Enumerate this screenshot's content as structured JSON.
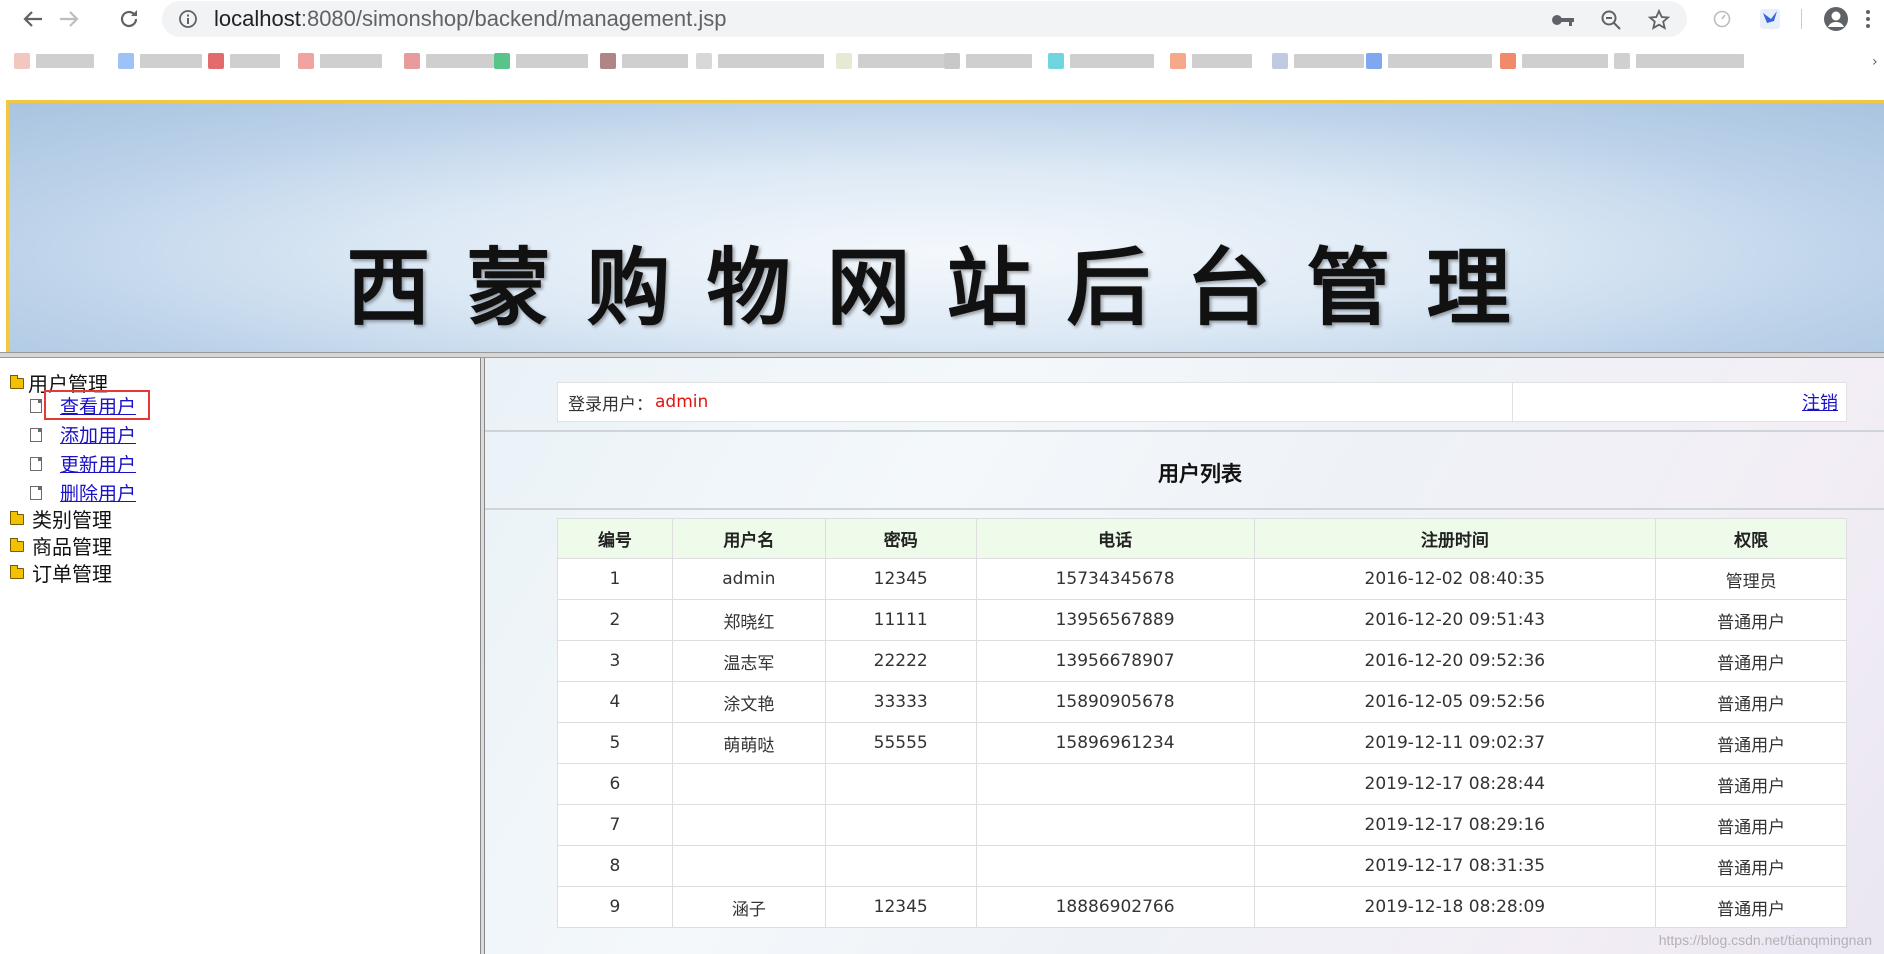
{
  "browser": {
    "url_host": "localhost",
    "url_rest": ":8080/simonshop/backend/management.jsp",
    "bookmark_count": 14
  },
  "header": {
    "title": "西蒙购物网站后台管理"
  },
  "sidebar": {
    "groups": [
      {
        "label": "用户管理",
        "children": [
          "查看用户",
          "添加用户",
          "更新用户",
          "删除用户"
        ]
      },
      {
        "label": "类别管理"
      },
      {
        "label": "商品管理"
      },
      {
        "label": "订单管理"
      }
    ],
    "selected": "查看用户"
  },
  "login": {
    "label": "登录用户：",
    "username": "admin",
    "logout": "注销"
  },
  "list": {
    "title": "用户列表",
    "columns": [
      "编号",
      "用户名",
      "密码",
      "电话",
      "注册时间",
      "权限"
    ],
    "rows": [
      [
        "1",
        "admin",
        "12345",
        "15734345678",
        "2016-12-02 08:40:35",
        "管理员"
      ],
      [
        "2",
        "郑晓红",
        "11111",
        "13956567889",
        "2016-12-20 09:51:43",
        "普通用户"
      ],
      [
        "3",
        "温志军",
        "22222",
        "13956678907",
        "2016-12-20 09:52:36",
        "普通用户"
      ],
      [
        "4",
        "涂文艳",
        "33333",
        "15890905678",
        "2016-12-05 09:52:56",
        "普通用户"
      ],
      [
        "5",
        "萌萌哒",
        "55555",
        "15896961234",
        "2019-12-11 09:02:37",
        "普通用户"
      ],
      [
        "6",
        "",
        "",
        "",
        "2019-12-17 08:28:44",
        "普通用户"
      ],
      [
        "7",
        "",
        "",
        "",
        "2019-12-17 08:29:16",
        "普通用户"
      ],
      [
        "8",
        "",
        "",
        "",
        "2019-12-17 08:31:35",
        "普通用户"
      ],
      [
        "9",
        "涵子",
        "12345",
        "18886902766",
        "2019-12-18 08:28:09",
        "普通用户"
      ]
    ]
  },
  "watermark": "https://blog.csdn.net/tianqmingnan"
}
